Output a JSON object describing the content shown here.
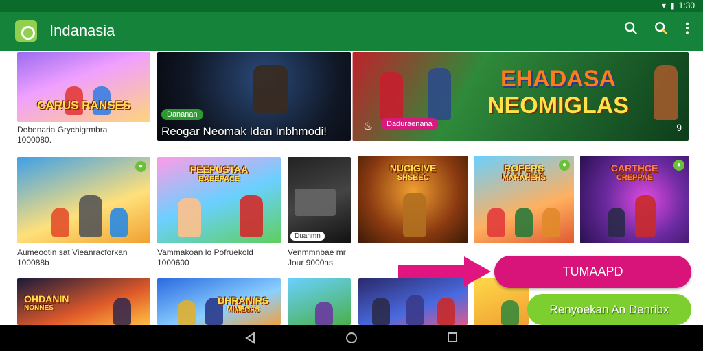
{
  "status_bar": {
    "time": "1:30"
  },
  "app_bar": {
    "title": "Indanasia"
  },
  "row1": {
    "tile1": {
      "title": "CARUS RANSES",
      "caption_line1": "Debenaria Grychigrmbra",
      "caption_line2": "1000080."
    },
    "tile2": {
      "badge": "Dananan",
      "text": "Reogar Neomak Idan Inbhmodi!"
    },
    "tile3": {
      "title_line1": "EHADASA",
      "title_line2": "NEOMIGLAS",
      "badge": "Daduraenana",
      "count": "9"
    }
  },
  "row2": {
    "tile1": {
      "caption_line1": "Aumeootin sat Vieanracforkan",
      "caption_line2": "100088b"
    },
    "tile2": {
      "title_line1": "PEEPUSTAA",
      "title_line2": "BAEEPACE",
      "caption_line1": "Vammakoan lo Pofruekold",
      "caption_line2": "1000600"
    },
    "tile3": {
      "label": "Duanmn",
      "caption_line1": "Venmmnbae mr",
      "caption_line2": "Jour 9000as"
    },
    "tile4": {
      "title_line1": "NUCIGIVE",
      "title_line2": "SHSBEC"
    },
    "tile5": {
      "title_line1": "ROFERS",
      "title_line2": "MARAHERS"
    },
    "tile6": {
      "title_line1": "CARTHCE",
      "title_line2": "CREPPAE"
    }
  },
  "row3": {
    "tile1": {
      "title_line1": "OHDANIN",
      "title_line2": "NONNES"
    },
    "tile2": {
      "title_line1": "DHRANIRS",
      "title_line2": "MIMEGAS"
    }
  },
  "buttons": {
    "primary": "TUMAAPD",
    "secondary": "Renyoekan An Denribx"
  },
  "colors": {
    "app_bar": "#15843a",
    "status_bar": "#0b6b2a",
    "primary_button": "#d8147a",
    "secondary_button": "#7ccf2e",
    "arrow": "#e0157f"
  }
}
